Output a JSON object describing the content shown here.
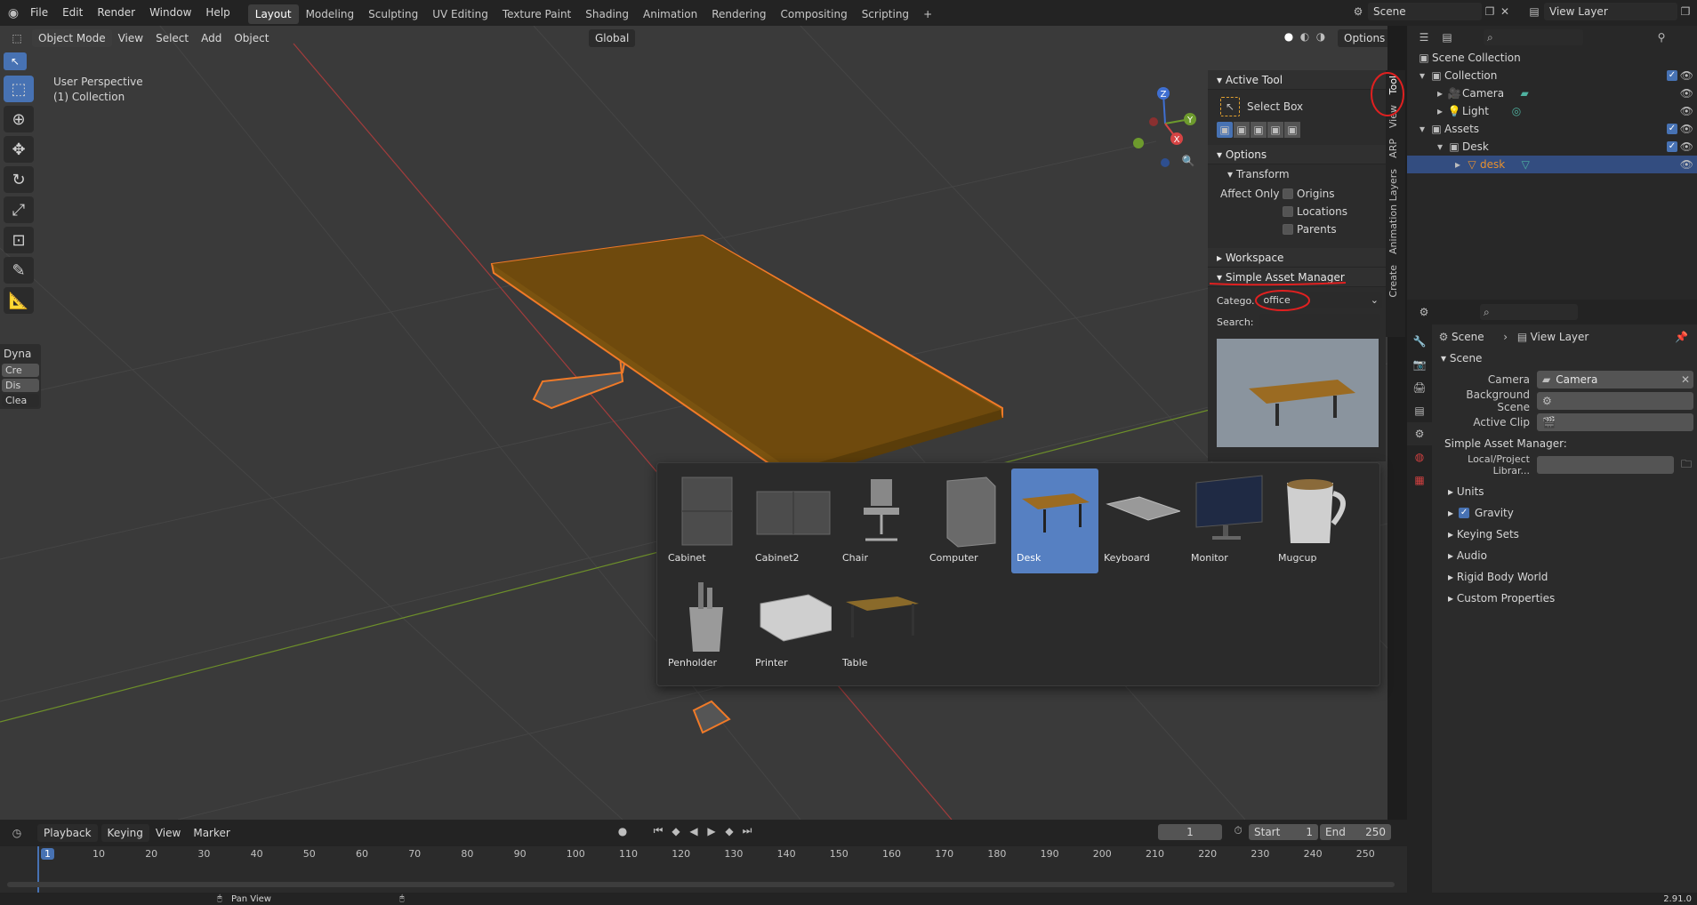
{
  "topbar": {
    "menus": [
      "File",
      "Edit",
      "Render",
      "Window",
      "Help"
    ],
    "workspaces": [
      "Layout",
      "Modeling",
      "Sculpting",
      "UV Editing",
      "Texture Paint",
      "Shading",
      "Animation",
      "Rendering",
      "Compositing",
      "Scripting"
    ],
    "active_workspace": "Layout",
    "add_tab": "+",
    "scene": "Scene",
    "view_layer": "View Layer"
  },
  "viewport": {
    "mode": "Object Mode",
    "menus": [
      "View",
      "Select",
      "Add",
      "Object"
    ],
    "orientation": "Global",
    "options": "Options",
    "perspective_label": "User Perspective",
    "collection_label": "(1) Collection",
    "gizmo": {
      "x": "X",
      "y": "Y",
      "z": "Z"
    },
    "last_op": {
      "title": "Dyna",
      "items": [
        "Cre",
        "Dis",
        "Clea"
      ]
    }
  },
  "npanel": {
    "active_tool_title": "Active Tool",
    "tool_name": "Select Box",
    "options_title": "Options",
    "transform_title": "Transform",
    "affect_only": "Affect Only",
    "checkboxes": [
      "Origins",
      "Locations",
      "Parents"
    ],
    "workspace_title": "Workspace",
    "sam_title": "Simple Asset Manager",
    "category_label": "Catego.",
    "category_value": "office",
    "search_label": "Search:",
    "side_tabs": [
      "Tool",
      "View",
      "ARP",
      "Animation Layers",
      "Create"
    ]
  },
  "assets": [
    {
      "name": "Cabinet"
    },
    {
      "name": "Cabinet2"
    },
    {
      "name": "Chair"
    },
    {
      "name": "Computer"
    },
    {
      "name": "Desk",
      "selected": true
    },
    {
      "name": "Keyboard"
    },
    {
      "name": "Monitor"
    },
    {
      "name": "Mugcup"
    },
    {
      "name": "Penholder"
    },
    {
      "name": "Printer"
    },
    {
      "name": "Table"
    }
  ],
  "timeline": {
    "menus": [
      "Playback",
      "Keying",
      "View",
      "Marker"
    ],
    "current_frame": "1",
    "start_label": "Start",
    "start": "1",
    "end_label": "End",
    "end": "250",
    "ticks": [
      "1",
      "10",
      "20",
      "30",
      "40",
      "50",
      "60",
      "70",
      "80",
      "90",
      "100",
      "110",
      "120",
      "130",
      "140",
      "150",
      "160",
      "170",
      "180",
      "190",
      "200",
      "210",
      "220",
      "230",
      "240",
      "250"
    ]
  },
  "status": {
    "pan": "Pan View",
    "version": "2.91.0"
  },
  "outliner": {
    "rows": [
      {
        "label": "Scene Collection",
        "indent": 0
      },
      {
        "label": "Collection",
        "indent": 1
      },
      {
        "label": "Camera",
        "indent": 2
      },
      {
        "label": "Light",
        "indent": 2
      },
      {
        "label": "Assets",
        "indent": 1
      },
      {
        "label": "Desk",
        "indent": 2
      },
      {
        "label": "desk",
        "indent": 3,
        "selected": true
      }
    ]
  },
  "props": {
    "breadcrumb_scene": "Scene",
    "breadcrumb_layer": "View Layer",
    "scene_section": "Scene",
    "camera_label": "Camera",
    "camera_value": "Camera",
    "bg_scene_label": "Background Scene",
    "active_clip_label": "Active Clip",
    "sam_label": "Simple Asset Manager:",
    "library_label": "Local/Project Librar...",
    "sections": [
      "Units",
      "Gravity",
      "Keying Sets",
      "Audio",
      "Rigid Body World",
      "Custom Properties"
    ]
  }
}
